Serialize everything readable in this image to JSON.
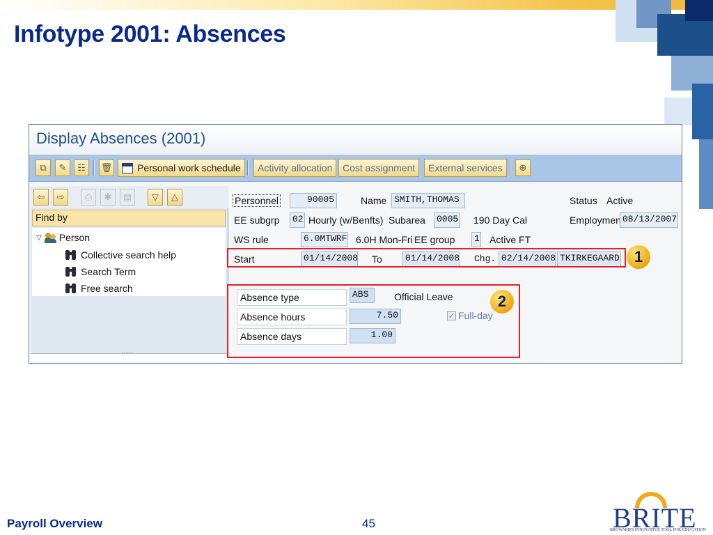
{
  "slide": {
    "title": "Infotype 2001: Absences",
    "footer_left": "Payroll Overview",
    "page_number": "45",
    "logo_text": "BRITE",
    "logo_tagline": "BROWARD'S INNOVATIVE TOOL FOR EDUCATION"
  },
  "window": {
    "title": "Display Absences (2001)"
  },
  "toolbar": {
    "personal_work_schedule": "Personal work schedule",
    "activity_allocation": "Activity allocation",
    "cost_assignment": "Cost assignment",
    "external_services": "External services"
  },
  "nav": {
    "find_by": "Find by",
    "person": "Person",
    "items": [
      "Collective search help",
      "Search Term",
      "Free search"
    ],
    "grip": "....."
  },
  "header": {
    "personnel_label": "Personnel",
    "personnel_value": "90005",
    "name_label": "Name",
    "name_value": "SMITH,THOMAS",
    "status_label": "Status",
    "status_value": "Active",
    "ee_subgrp_label": "EE subgrp",
    "ee_subgrp_value": "02",
    "ee_subgrp_text": "Hourly (w/Benfts)",
    "subarea_label": "Subarea",
    "subarea_value": "0005",
    "subarea_text": "190 Day Cal",
    "employment_label": "Employmen",
    "employment_value": "08/13/2007",
    "ws_rule_label": "WS rule",
    "ws_rule_value": "6.0MTWRF",
    "ws_rule_text": "6.0H Mon-Fri",
    "ee_group_label": "EE group",
    "ee_group_value": "1",
    "ee_group_text": "Active FT",
    "start_label": "Start",
    "start_value": "01/14/2008",
    "to_label": "To",
    "to_value": "01/14/2008",
    "chg_label": "Chg.",
    "chg_date": "02/14/2008",
    "chg_user": "TKIRKEGAARD"
  },
  "absence": {
    "type_label": "Absence type",
    "type_value": "ABS",
    "type_text": "Official Leave",
    "hours_label": "Absence hours",
    "hours_value": "7.50",
    "days_label": "Absence days",
    "days_value": "1.00",
    "fullday_label": "Full-day",
    "fullday_checked": true
  },
  "callouts": {
    "one": "1",
    "two": "2"
  },
  "colors": {
    "title_blue": "#0a2a8a",
    "callout_red": "#e0202a",
    "callout_badge": "#f2b21a",
    "toolbar_blue": "#a9c6e6"
  },
  "icons": {
    "toolbar": [
      "copy-icon",
      "create-icon",
      "overview-icon",
      "delete-icon",
      "calendar-icon",
      "create-object-icon"
    ],
    "nav_toolbar": [
      "back-icon",
      "forward-icon",
      "print-icon",
      "collapse-all-icon",
      "expand-all-icon"
    ],
    "tree": [
      "person-icon",
      "binoculars-icon"
    ]
  }
}
